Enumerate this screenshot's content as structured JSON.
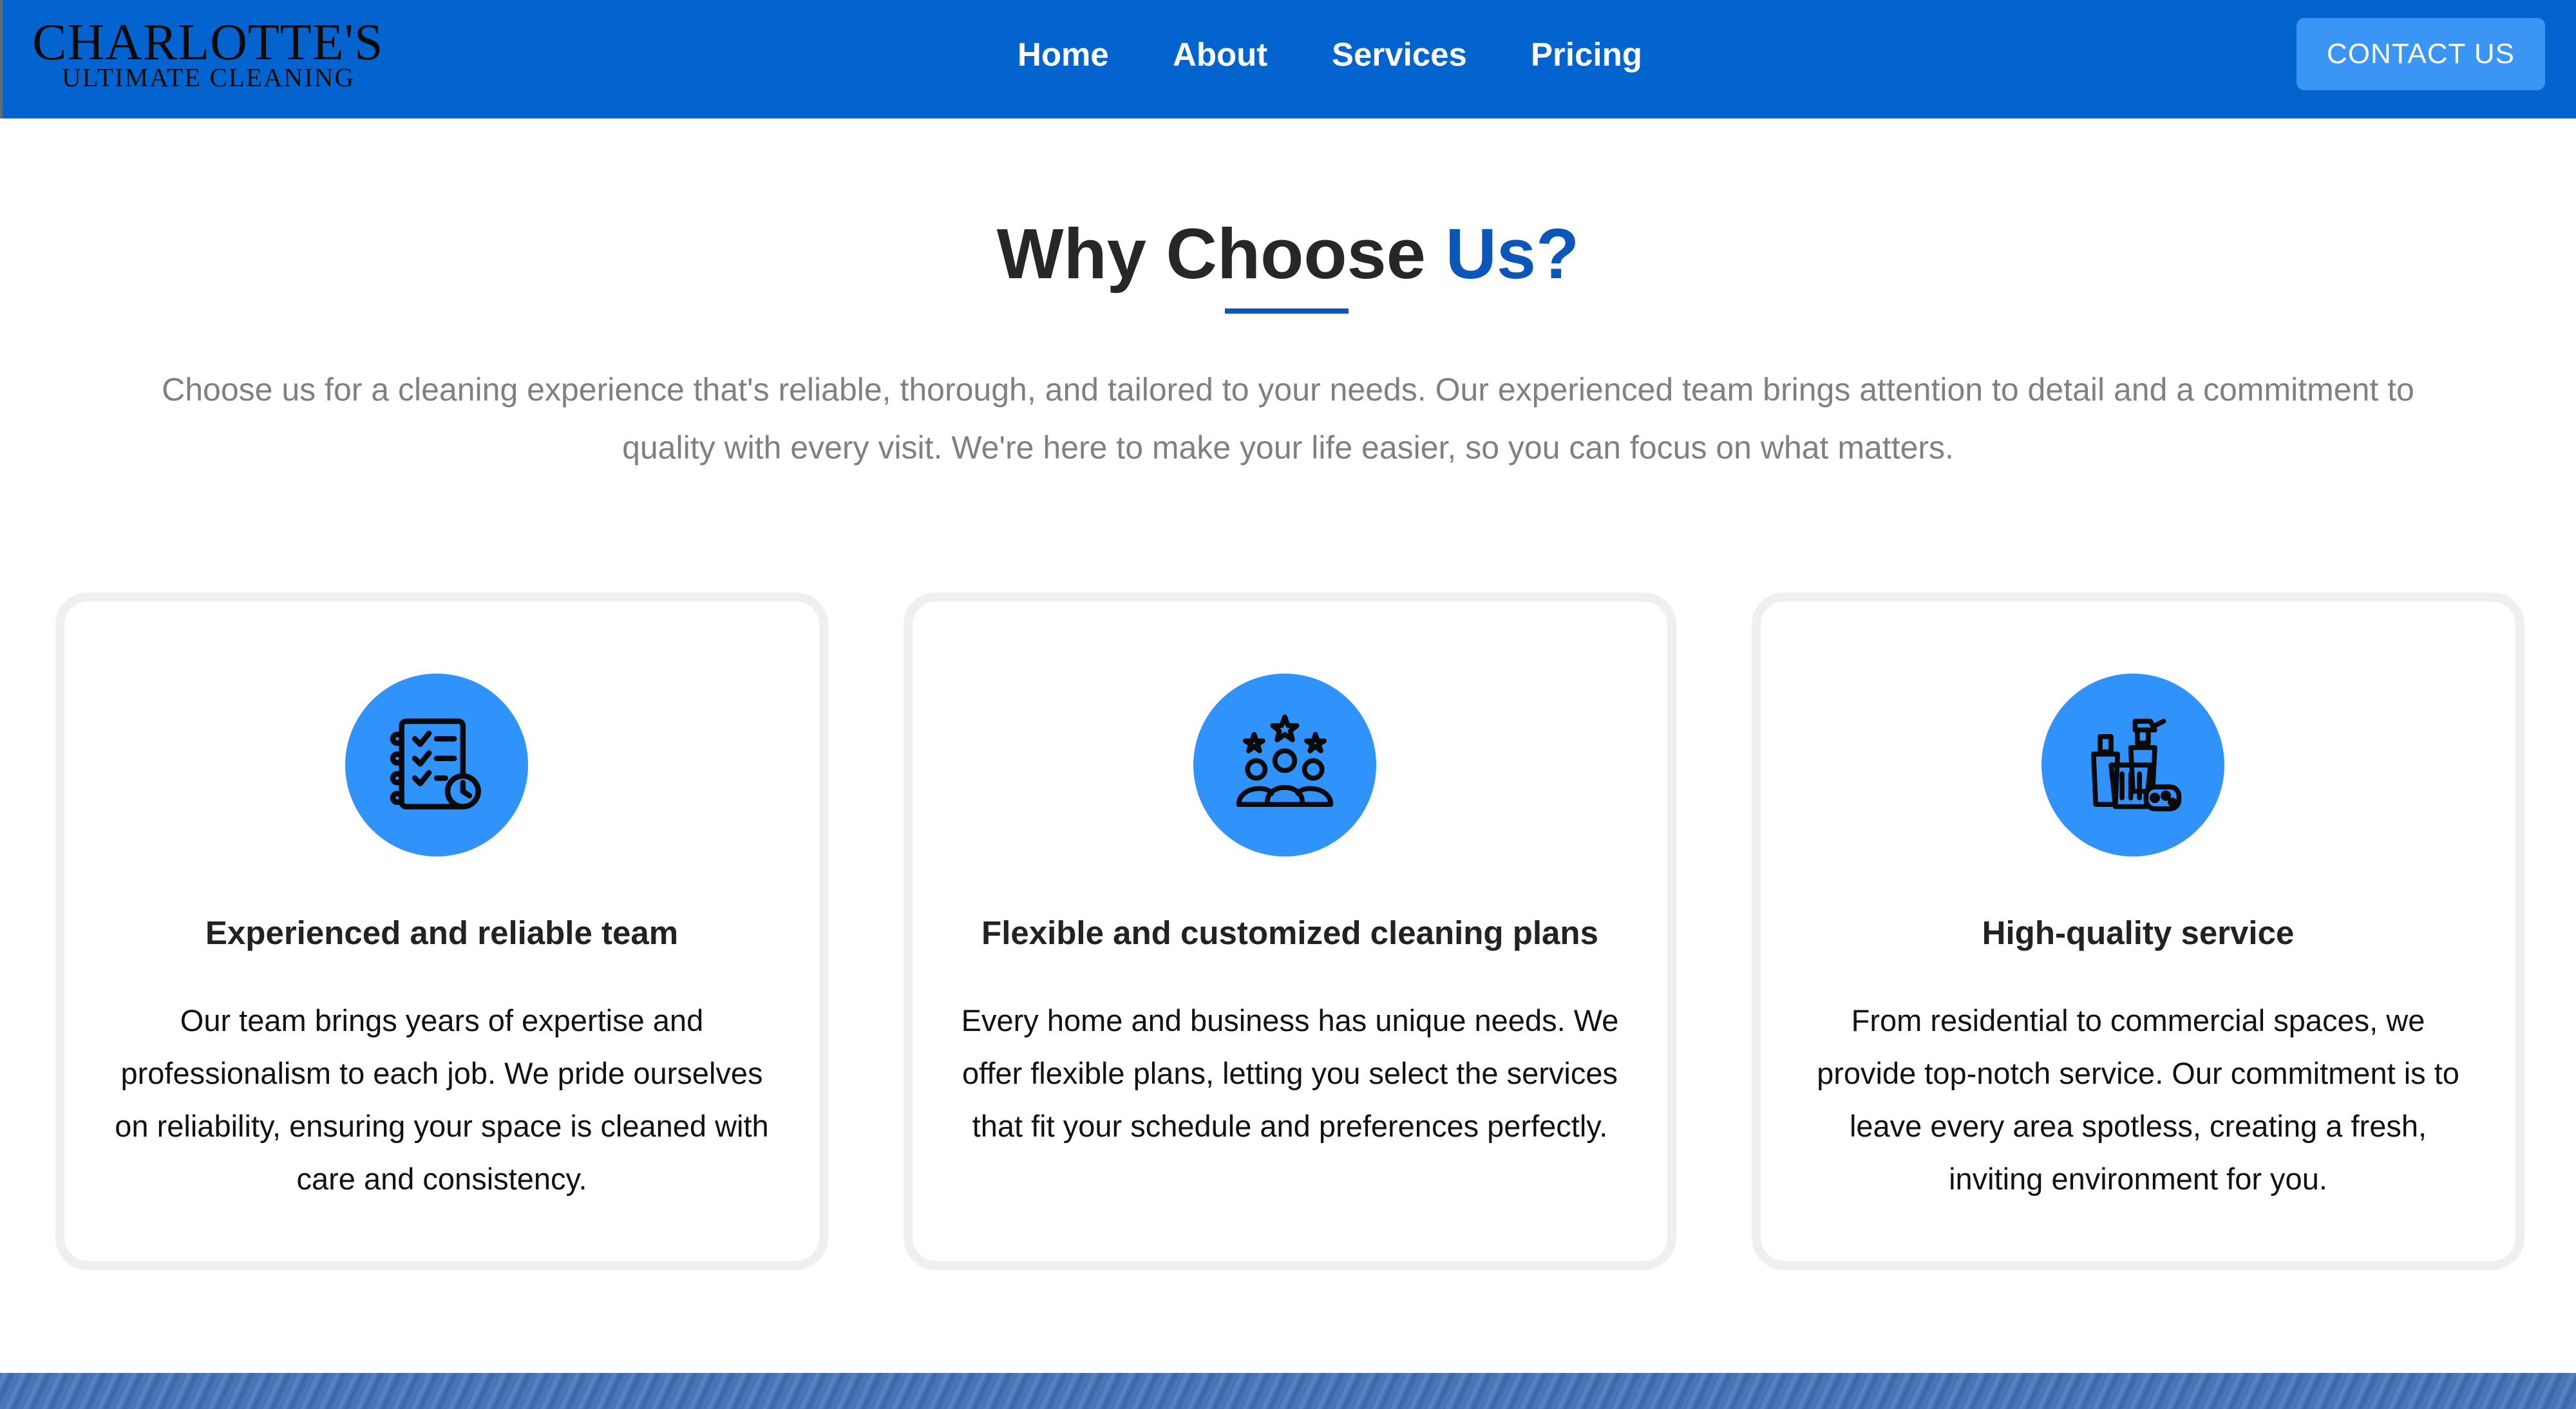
{
  "header": {
    "logo_main": "CHARLOTTE'S",
    "logo_sub": "ULTIMATE CLEANING",
    "nav": [
      "Home",
      "About",
      "Services",
      "Pricing"
    ],
    "contact_label": "CONTACT US"
  },
  "section": {
    "title_main": "Why Choose",
    "title_accent": "Us?",
    "intro": "Choose us for a cleaning experience that's reliable, thorough, and tailored to your needs. Our experienced team brings attention to detail and a commitment to quality with every visit. We're here to make your life easier, so you can focus on what matters."
  },
  "cards": [
    {
      "icon": "checklist-clock-icon",
      "title": "Experienced and reliable team",
      "text": "Our team brings years of expertise and professionalism to each job. We pride ourselves on reliability, ensuring your space is cleaned with care and consistency."
    },
    {
      "icon": "team-stars-icon",
      "title": "Flexible and customized cleaning plans",
      "text": "Every home and business has unique needs. We offer flexible plans, letting you select the services that fit your schedule and preferences perfectly."
    },
    {
      "icon": "cleaning-supplies-icon",
      "title": "High-quality service",
      "text": "From residential to commercial spaces, we provide top-notch service. Our commitment is to leave every area spotless, creating a fresh, inviting environment for you."
    }
  ],
  "colors": {
    "header_bg": "#0464cf",
    "accent": "#0a56bb",
    "icon_circle": "#2f93fb",
    "button": "#3a95f5"
  }
}
